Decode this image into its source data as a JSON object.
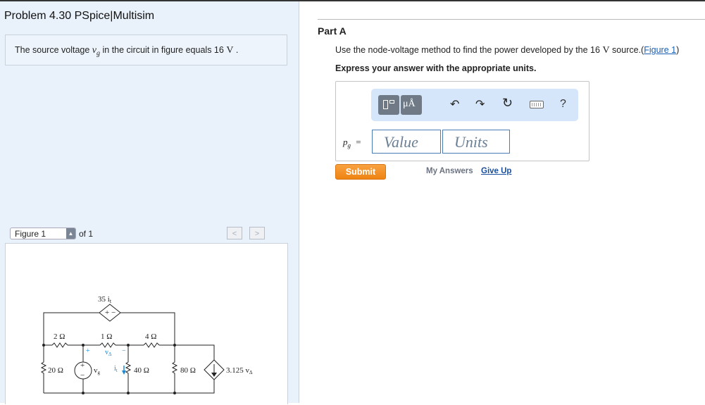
{
  "problem": {
    "title": "Problem 4.30 PSpice|Multisim",
    "statement": {
      "prefix": "The source voltage",
      "var": "v",
      "var_sub": "g",
      "middle": "in the circuit in figure equals 16",
      "unit": "V",
      "suffix": "."
    }
  },
  "figure": {
    "select_label": "Figure 1",
    "of_text": "of 1",
    "prev_icon": "chevron-left-icon",
    "next_icon": "chevron-right-icon",
    "prev_glyph": "<",
    "next_glyph": ">",
    "circuit": {
      "labels": {
        "dep_vsrc": "35 i",
        "dep_vsrc_sub": "t",
        "r2": "2 Ω",
        "r1": "1 Ω",
        "r4": "4 Ω",
        "r20": "20 Ω",
        "r40": "40 Ω",
        "r80": "80 Ω",
        "vdelta": "v",
        "vdelta_sub": "Δ",
        "vg": "v",
        "vg_sub": "g",
        "it": "i",
        "it_sub": "t",
        "dep_isrc": "3.125 v",
        "dep_isrc_sub": "Δ",
        "plus": "+",
        "minus": "−",
        "plus_minus": "+ −"
      }
    }
  },
  "part": {
    "label": "Part A",
    "question_prefix": "Use the node-voltage method to find the power developed by the 16",
    "question_unit": "V",
    "question_suffix": "source.",
    "figure_link": "Figure 1",
    "paren_open": "(",
    "paren_close": ")",
    "units_note": "Express your answer with the appropriate units."
  },
  "toolbar": {
    "items": [
      "templates-icon",
      "units-mu-a-icon",
      "undo-icon",
      "redo-icon",
      "reset-icon",
      "keyboard-icon",
      "help-icon"
    ],
    "mu_a": "μÅ",
    "undo": "↶",
    "redo": "↷",
    "reset": "↻",
    "help": "?"
  },
  "answer": {
    "var": "p",
    "var_sub": "g",
    "equals": "=",
    "value_placeholder": "Value",
    "units_placeholder": "Units"
  },
  "actions": {
    "submit": "Submit",
    "my_answers": "My Answers",
    "give_up": "Give Up"
  },
  "colors": {
    "submit_orange": "#ef8412",
    "link_blue": "#1a5fb4",
    "left_panel_bg": "#e9f1fb",
    "toolbar_bg": "#d5e6fa",
    "current_arrow": "#1e8ad6"
  }
}
